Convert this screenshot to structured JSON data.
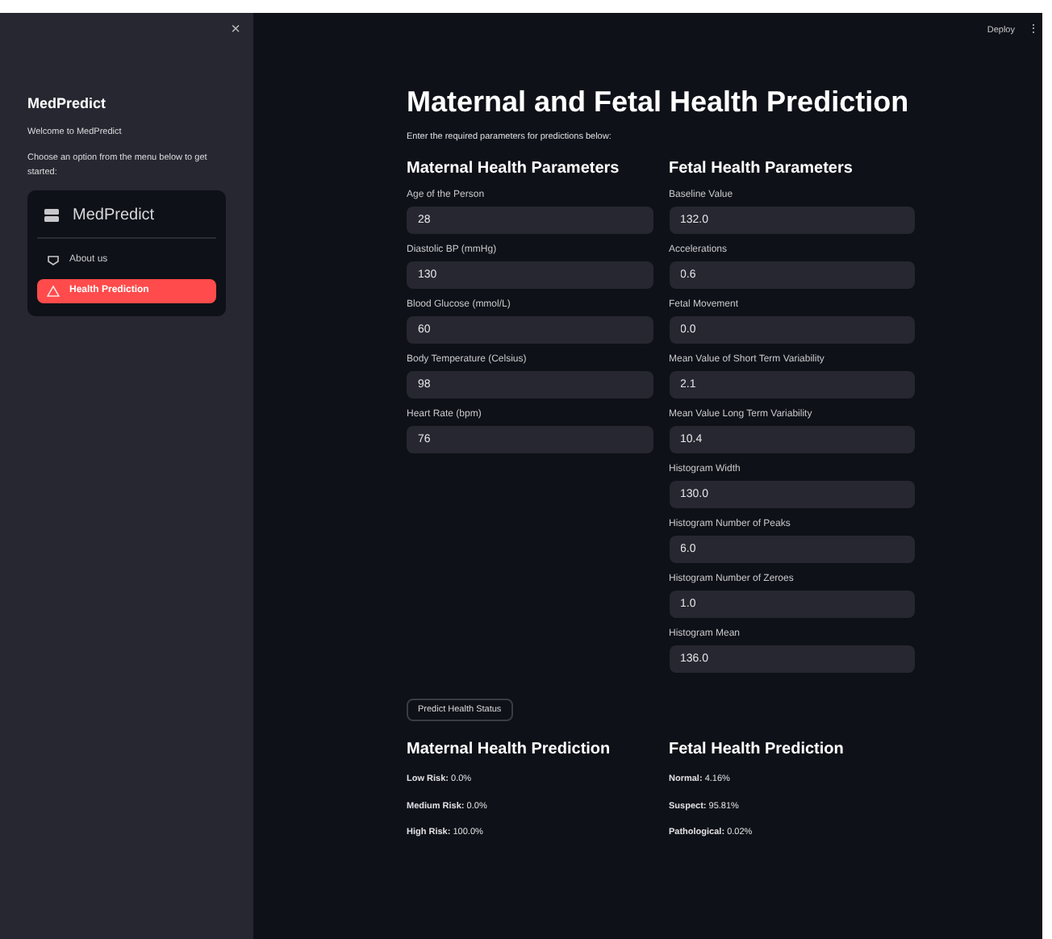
{
  "sidebar": {
    "close": "×",
    "title": "MedPredict",
    "welcome": "Welcome to MedPredict",
    "instruction": "Choose an option from the menu below to get started:",
    "menu": {
      "title": "MedPredict",
      "items": [
        {
          "label": "About us",
          "selected": false
        },
        {
          "label": "Health Prediction",
          "selected": true
        }
      ]
    }
  },
  "header": {
    "deploy": "Deploy",
    "more": "⋮"
  },
  "main": {
    "title": "Maternal and Fetal Health Prediction",
    "subtitle": "Enter the required parameters for predictions below:",
    "maternal": {
      "heading": "Maternal Health Parameters",
      "fields": [
        {
          "label": "Age of the Person",
          "value": "28"
        },
        {
          "label": "Diastolic BP (mmHg)",
          "value": "130"
        },
        {
          "label": "Blood Glucose (mmol/L)",
          "value": "60"
        },
        {
          "label": "Body Temperature (Celsius)",
          "value": "98"
        },
        {
          "label": "Heart Rate (bpm)",
          "value": "76"
        }
      ]
    },
    "fetal": {
      "heading": "Fetal Health Parameters",
      "fields": [
        {
          "label": "Baseline Value",
          "value": "132.0"
        },
        {
          "label": "Accelerations",
          "value": "0.6"
        },
        {
          "label": "Fetal Movement",
          "value": "0.0"
        },
        {
          "label": "Mean Value of Short Term Variability",
          "value": "2.1"
        },
        {
          "label": "Mean Value Long Term Variability",
          "value": "10.4"
        },
        {
          "label": "Histogram Width",
          "value": "130.0"
        },
        {
          "label": "Histogram Number of Peaks",
          "value": "6.0"
        },
        {
          "label": "Histogram Number of Zeroes",
          "value": "1.0"
        },
        {
          "label": "Histogram Mean",
          "value": "136.0"
        }
      ]
    },
    "button": "Predict Health Status",
    "results": [
      {
        "heading": "Maternal Health Prediction",
        "lines": [
          {
            "label": "Low Risk:",
            "value": "0.0%"
          },
          {
            "label": "Medium Risk:",
            "value": "0.0%"
          },
          {
            "label": "High Risk:",
            "value": "100.0%"
          }
        ]
      },
      {
        "heading": "Fetal Health Prediction",
        "lines": [
          {
            "label": "Normal:",
            "value": "4.16%"
          },
          {
            "label": "Suspect:",
            "value": "95.81%"
          },
          {
            "label": "Pathological:",
            "value": "0.02%"
          }
        ]
      }
    ]
  }
}
